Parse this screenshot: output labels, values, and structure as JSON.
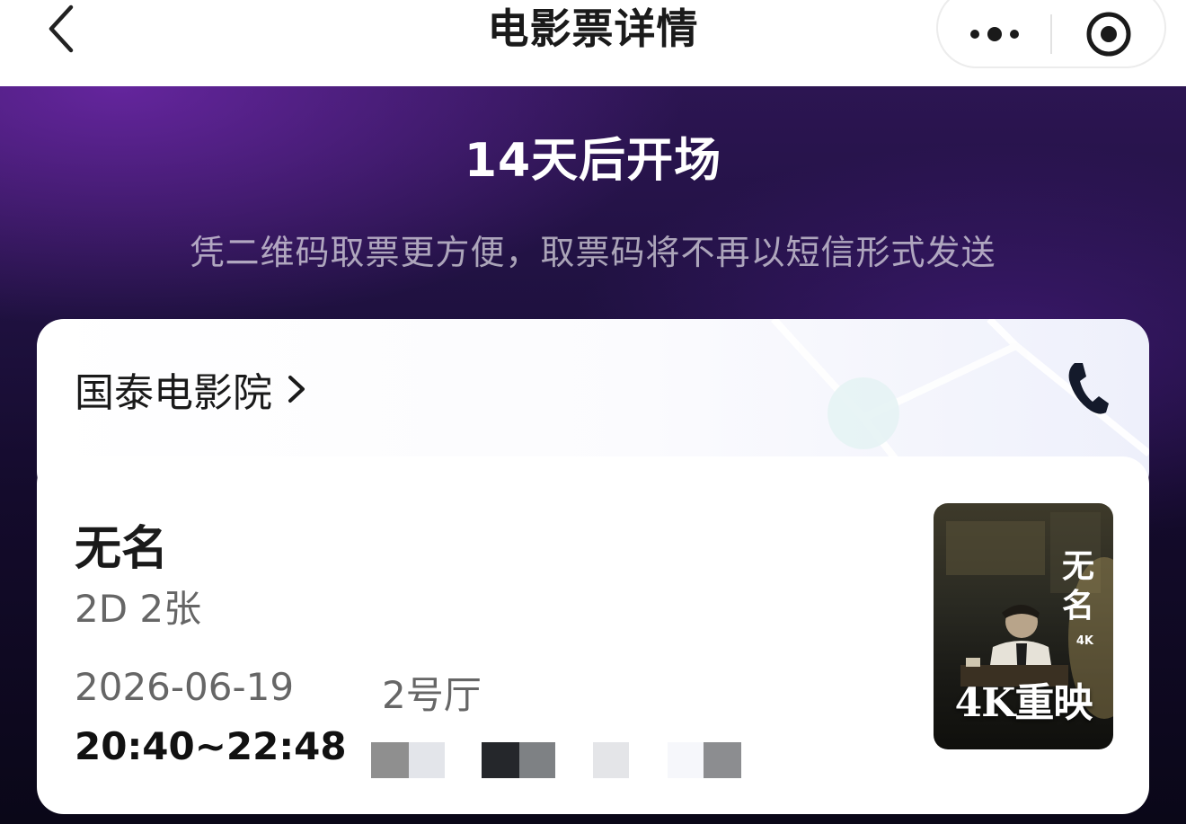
{
  "nav": {
    "title": "电影票详情",
    "back_icon": "chevron-left-icon",
    "more_icon": "more-dots-icon",
    "close_icon": "target-circle-icon"
  },
  "banner": {
    "headline": "14天后开场",
    "subtitle": "凭二维码取票更方便，取票码将不再以短信形式发送"
  },
  "cinema": {
    "name": "国泰电影院",
    "chevron_icon": "chevron-right-icon",
    "phone_icon": "phone-icon"
  },
  "movie": {
    "title": "无名",
    "meta": "2D 2张",
    "date": "2026-06-19",
    "hall": "2号厅",
    "time": "20:40~22:48",
    "seats_note": "seat numbers obscured",
    "poster": {
      "title": "无名",
      "tag": "4K",
      "caption": "4K重映"
    }
  },
  "colors": {
    "banner_top": "#2c1552",
    "banner_bottom": "#0a0718",
    "text_primary": "#1a1a1a",
    "text_secondary": "#666666"
  }
}
